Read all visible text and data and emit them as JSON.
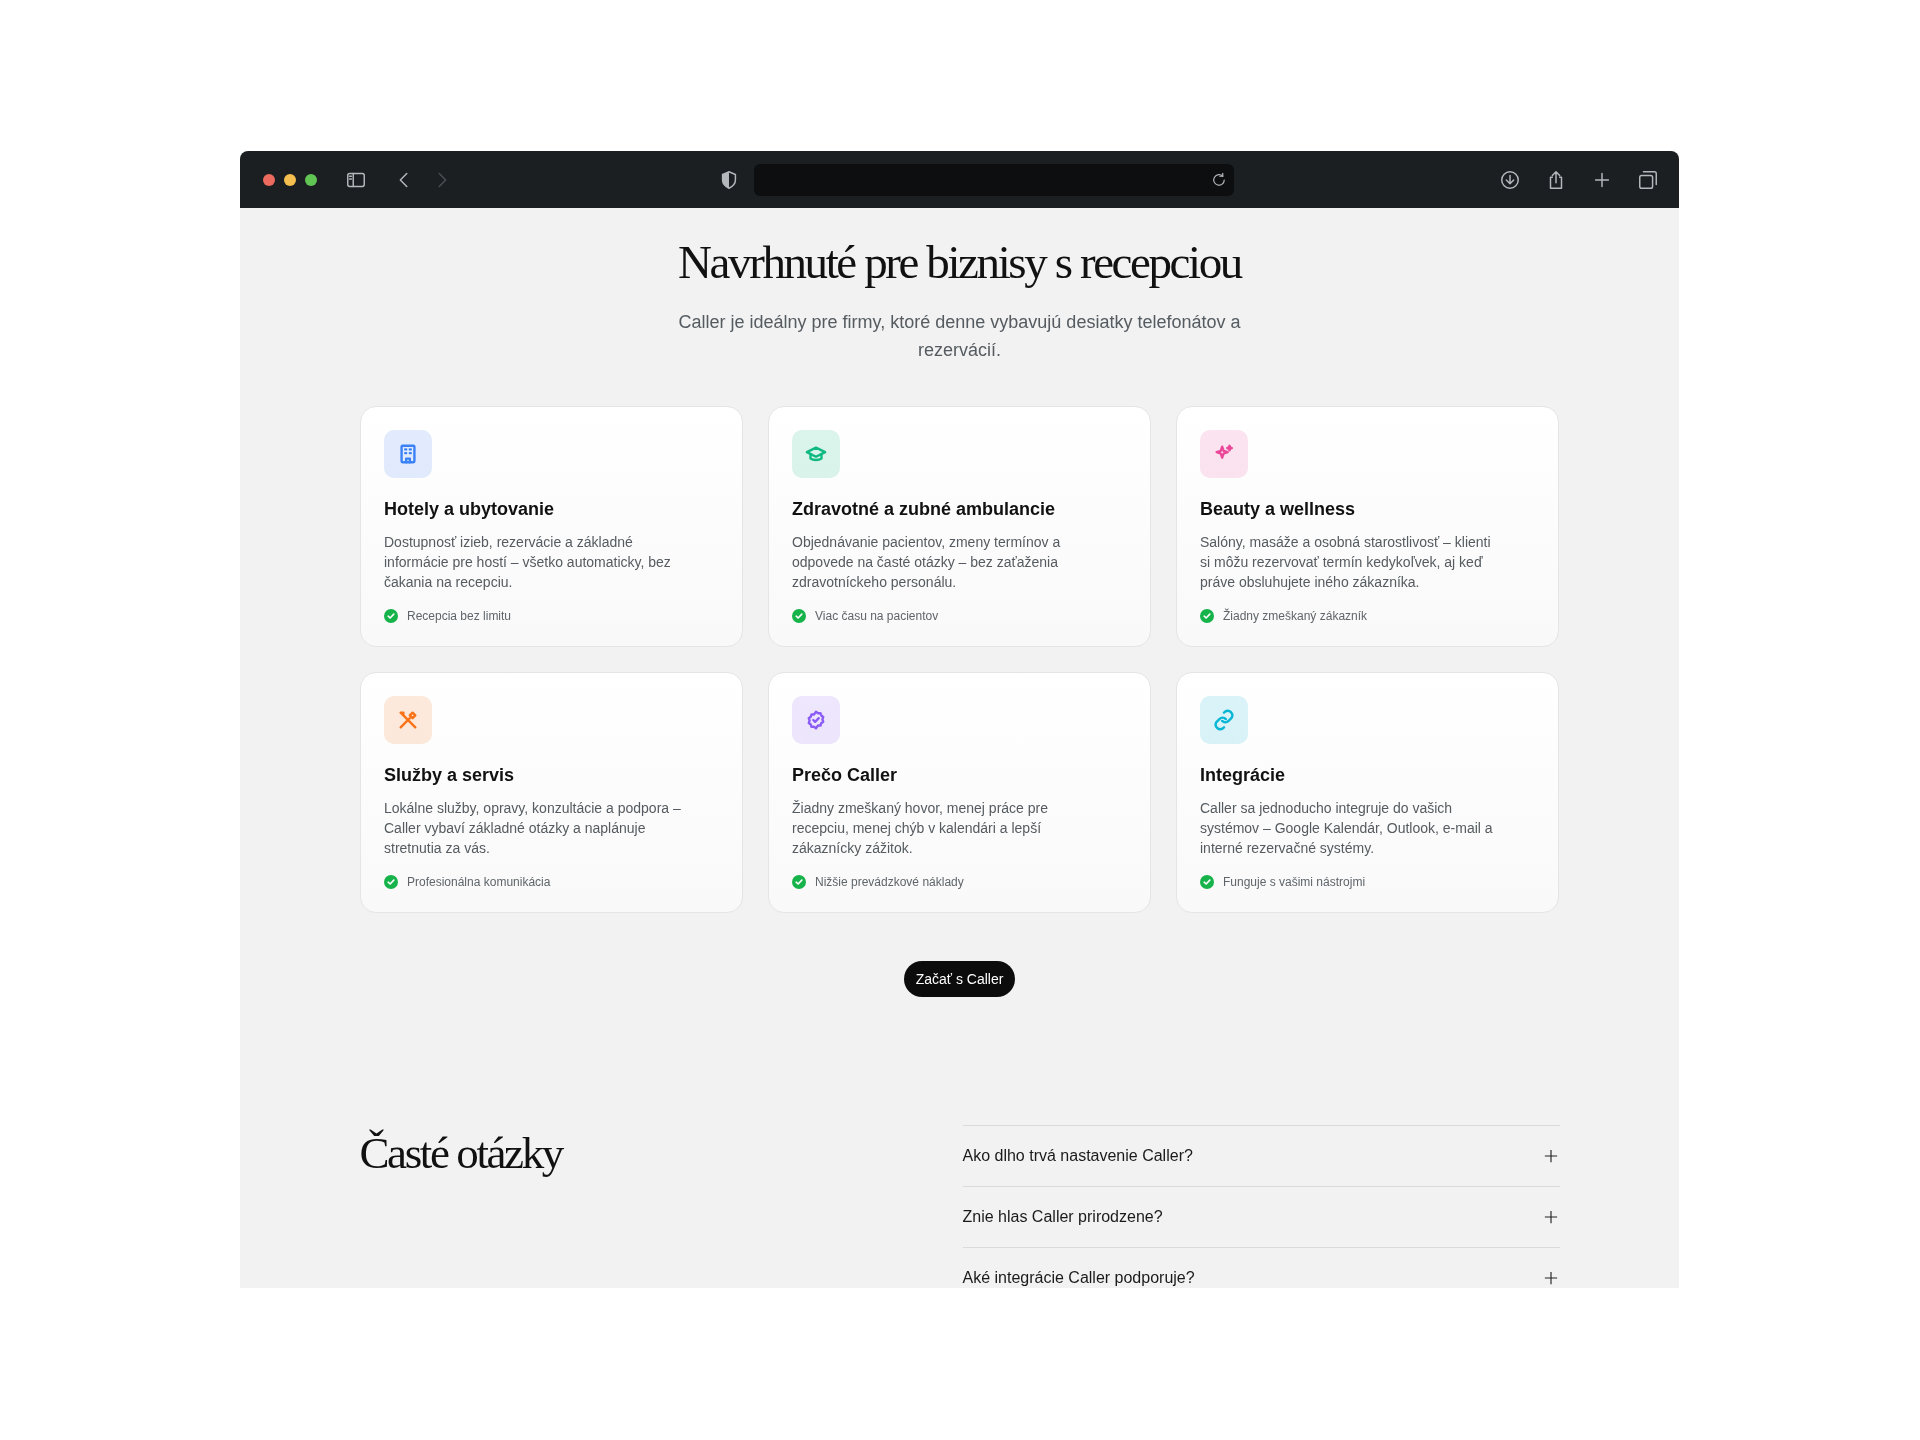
{
  "browser": {
    "back": {
      "disabled": false
    },
    "forward": {
      "disabled": true
    }
  },
  "hero": {
    "title": "Navrhnuté pre biznisy s recepciou",
    "subtitle": "Caller je ideálny pre firmy, ktoré denne vybavujú desiatky telefonátov a rezervácií."
  },
  "cards": [
    {
      "title": "Hotely a ubytovanie",
      "text": "Dostupnosť izieb, rezervácie a základné informácie pre hostí – všetko automaticky, bez čakania na recepciu.",
      "feature": "Recepcia bez limitu",
      "color": "#3b82f6"
    },
    {
      "title": "Zdravotné a zubné ambulancie",
      "text": "Objednávanie pacientov, zmeny termínov a odpovede na časté otázky – bez zaťaženia zdravotníckeho personálu.",
      "feature": "Viac času na pacientov",
      "color": "#10b981"
    },
    {
      "title": "Beauty a wellness",
      "text": "Salóny, masáže a osobná starostlivosť – klienti si môžu rezervovať termín kedykoľvek, aj keď práve obsluhujete iného zákazníka.",
      "feature": "Žiadny zmeškaný zákazník",
      "color": "#ec4899"
    },
    {
      "title": "Služby a servis",
      "text": "Lokálne služby, opravy, konzultácie a podpora – Caller vybaví základné otázky a naplánuje stretnutia za vás.",
      "feature": "Profesionálna komunikácia",
      "color": "#f97316"
    },
    {
      "title": "Prečo Caller",
      "text": "Žiadny zmeškaný hovor, menej práce pre recepciu, menej chýb v kalendári a lepší zákaznícky zážitok.",
      "feature": "Nižšie prevádzkové náklady",
      "color": "#8b5cf6"
    },
    {
      "title": "Integrácie",
      "text": "Caller sa jednoducho integruje do vašich systémov – Google Kalendár, Outlook, e-mail a interné rezervačné systémy.",
      "feature": "Funguje s vašimi nástrojmi",
      "color": "#06b6d4"
    }
  ],
  "cta": {
    "label": "Začať s Caller"
  },
  "faq": {
    "title": "Časté otázky",
    "items": [
      {
        "question": "Ako dlho trvá nastavenie Caller?",
        "expanded": false
      },
      {
        "question": "Znie hlas Caller prirodzene?",
        "expanded": false
      },
      {
        "question": "Aké integrácie Caller podporuje?",
        "expanded": false
      }
    ]
  }
}
